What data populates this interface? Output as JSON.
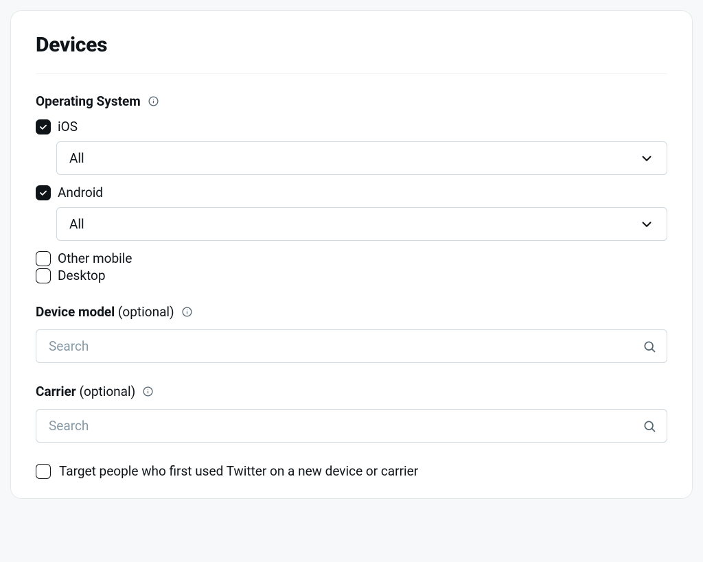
{
  "card": {
    "title": "Devices"
  },
  "os": {
    "label": "Operating System",
    "options": [
      {
        "label": "iOS",
        "checked": true,
        "dropdown_value": "All"
      },
      {
        "label": "Android",
        "checked": true,
        "dropdown_value": "All"
      },
      {
        "label": "Other mobile",
        "checked": false
      },
      {
        "label": "Desktop",
        "checked": false
      }
    ]
  },
  "device_model": {
    "label": "Device model",
    "optional": "(optional)",
    "placeholder": "Search"
  },
  "carrier": {
    "label": "Carrier",
    "optional": "(optional)",
    "placeholder": "Search"
  },
  "target_new_device": {
    "label": "Target people who first used Twitter on a new device or carrier",
    "checked": false
  }
}
